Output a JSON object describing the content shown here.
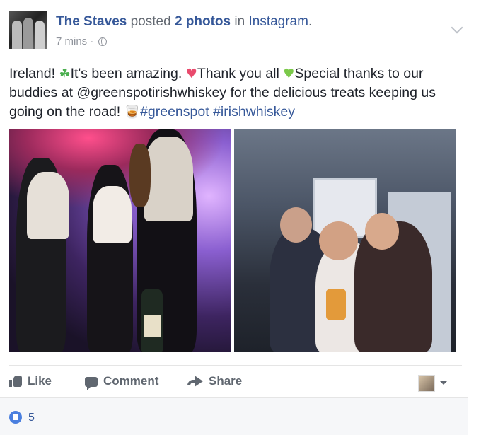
{
  "post": {
    "author": "The Staves",
    "posted": "posted",
    "photo_count": "2 photos",
    "in": "in",
    "app": "Instagram",
    "period": ".",
    "time": "7 mins",
    "separator": "·",
    "message": {
      "t1": "Ireland! ",
      "e1": "☘",
      "t2": "It's been amazing. ",
      "e2": "♥",
      "t3": "Thank you all ",
      "e3": "♥",
      "t4": "Special thanks to our buddies at @greenspotirishwhiskey for the delicious treats keeping us going on the road! ",
      "e4": "🥃",
      "tag1": "#greenspot",
      "space": " ",
      "tag2": "#irishwhiskey"
    },
    "emoji_colors": {
      "shamrock": "#4caf50",
      "red_heart": "#e94a6d",
      "green_heart": "#7bc94a",
      "glass": "#e8a23a"
    }
  },
  "actions": {
    "like": "Like",
    "comment": "Comment",
    "share": "Share"
  },
  "reactions": {
    "count": "5"
  },
  "colors": {
    "link": "#365899",
    "meta": "#90949c",
    "action": "#606770",
    "like_blue": "#4a7fdf"
  }
}
